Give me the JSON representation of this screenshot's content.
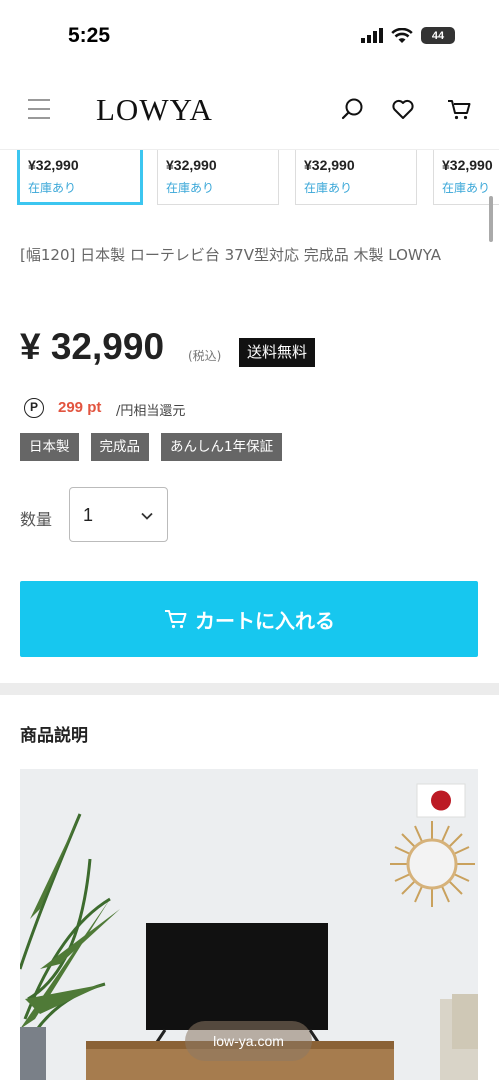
{
  "status_bar": {
    "time": "5:25",
    "battery": "44"
  },
  "header": {
    "logo": "LOWYA"
  },
  "variants": [
    {
      "price": "¥32,990",
      "stock": "在庫あり"
    },
    {
      "price": "¥32,990",
      "stock": "在庫あり"
    },
    {
      "price": "¥32,990",
      "stock": "在庫あり"
    },
    {
      "price": "¥32,990",
      "stock": "在庫あり"
    }
  ],
  "product": {
    "title": "[幅120] 日本製 ローテレビ台 37V型対応 完成品 木製  LOWYA",
    "price": "¥ 32,990",
    "tax_note": "(税込)",
    "shipping_badge": "送料無料",
    "points_icon": "P",
    "points_value": "299 pt",
    "points_suffix": "/円相当還元",
    "tags": [
      "日本製",
      "完成品",
      "あんしん1年保証"
    ]
  },
  "quantity": {
    "label": "数量",
    "value": "1"
  },
  "cart_button": {
    "label": "カートに入れる"
  },
  "description": {
    "heading": "商品説明"
  },
  "browser": {
    "url": "low-ya.com"
  },
  "colors": {
    "accent": "#17c7ef",
    "points": "#e2543f",
    "tag_bg": "#666666"
  }
}
